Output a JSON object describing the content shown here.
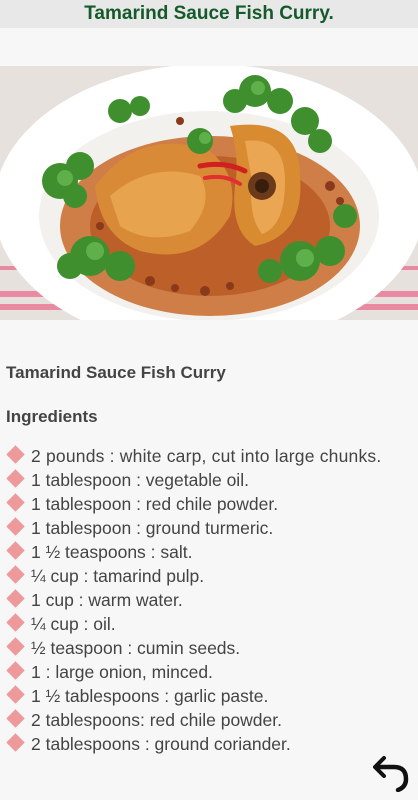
{
  "header": {
    "title": "Tamarind Sauce Fish Curry."
  },
  "recipe": {
    "title": "Tamarind Sauce Fish Curry",
    "ingredients_heading": "Ingredients",
    "ingredients": [
      "2 pounds : white carp, cut into large chunks.",
      "1 tablespoon : vegetable oil.",
      "1 tablespoon : red chile powder.",
      "1 tablespoon : ground turmeric.",
      "1 ½ teaspoons : salt.",
      "¼ cup : tamarind pulp.",
      "1 cup : warm water.",
      "¼ cup : oil.",
      "½ teaspoon : cumin seeds.",
      "1 : large onion, minced.",
      "1 ½ tablespoons : garlic paste.",
      "2 tablespoons: red chile powder.",
      "2 tablespoons : ground coriander."
    ]
  },
  "icons": {
    "bullet": "diamond-bullet-icon",
    "back": "back-arrow-icon"
  },
  "colors": {
    "title": "#155a2a",
    "bullet": "#ef9a9a",
    "text": "#444444"
  }
}
